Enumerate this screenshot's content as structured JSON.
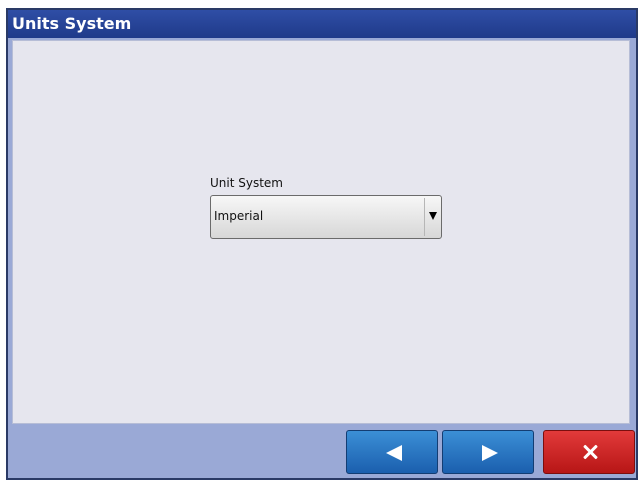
{
  "window": {
    "title": "Units System"
  },
  "form": {
    "unit_system": {
      "label": "Unit System",
      "value": "Imperial"
    }
  },
  "footer": {
    "back_icon": "left-arrow-icon",
    "next_icon": "right-arrow-icon",
    "close_icon": "close-icon"
  },
  "colors": {
    "titlebar": "#2f4ea6",
    "content_bg": "#e6e6ee",
    "footer_bg": "#9aa9d6",
    "primary_button": "#1b5fae",
    "danger_button": "#b71616"
  }
}
